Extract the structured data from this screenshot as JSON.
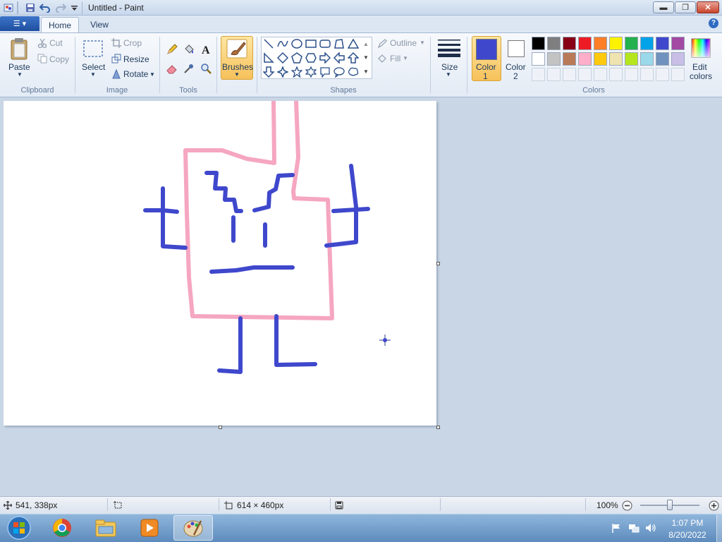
{
  "window": {
    "title": "Untitled - Paint",
    "min_glyph": "▬",
    "max_glyph": "❐",
    "close_glyph": "✕"
  },
  "menu": {
    "file_glyph": "☰ ▾"
  },
  "tabs": [
    {
      "label": "Home"
    },
    {
      "label": "View"
    }
  ],
  "help_glyph": "?",
  "ribbon": {
    "clipboard": {
      "group": "Clipboard",
      "paste": "Paste",
      "cut": "Cut",
      "copy": "Copy"
    },
    "image": {
      "group": "Image",
      "select": "Select",
      "crop": "Crop",
      "resize": "Resize",
      "rotate": "Rotate"
    },
    "tools": {
      "group": "Tools"
    },
    "brushes": {
      "label": "Brushes"
    },
    "shapes": {
      "group": "Shapes",
      "outline": "Outline",
      "fill": "Fill"
    },
    "size": {
      "label": "Size"
    },
    "colors": {
      "group": "Colors",
      "color1_line1": "Color",
      "color1_line2": "1",
      "color2_line1": "Color",
      "color2_line2": "2",
      "edit_line1": "Edit",
      "edit_line2": "colors",
      "color1_value": "#3f48cc",
      "color2_value": "#ffffff",
      "palette_row1": [
        "#000000",
        "#7f7f7f",
        "#880015",
        "#ed1c24",
        "#ff7f27",
        "#fff200",
        "#22b14c",
        "#00a2e8",
        "#3f48cc",
        "#a349a4"
      ],
      "palette_row2": [
        "#ffffff",
        "#c3c3c3",
        "#b97a57",
        "#ffaec9",
        "#ffc90e",
        "#efe4b0",
        "#b5e61d",
        "#99d9ea",
        "#7092be",
        "#c8bfe7"
      ]
    }
  },
  "drawing": {
    "pink": "#f5a6c1",
    "blue": "#3f48cc"
  },
  "status": {
    "cursor_pos": "541, 338px",
    "canvas_size": "614 × 460px",
    "zoom": "100%"
  },
  "taskbar": {
    "time": "1:07 PM",
    "date": "8/20/2022"
  }
}
